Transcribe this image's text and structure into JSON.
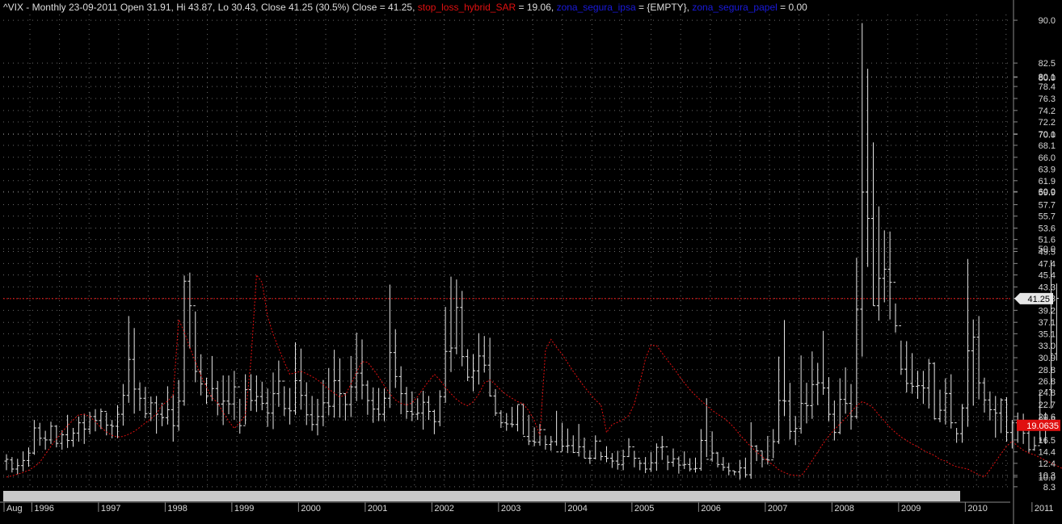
{
  "legend": {
    "symbol_line": "^VIX - Monthly 23-09-2011 Open 31.91, Hi 43.87, Lo 30.43, Close 41.25 (30.5%)",
    "close_label": "Close = 41.25,",
    "sar_name": "stop_loss_hybrid_SAR",
    "sar_value": "= 19.06,",
    "ipsa_name": "zona_segura_ipsa",
    "ipsa_value": "= {EMPTY},",
    "papel_name": "zona_segura_papel",
    "papel_value": "= 0.00"
  },
  "colors": {
    "background": "#000000",
    "bars": "#e6e6e6",
    "sar": "#e01010",
    "grid": "#6a6a6a",
    "last_close_tag": "#e6e6e6",
    "sar_tag": "#e01010"
  },
  "chart_data": {
    "type": "ohlc",
    "timeframe": "monthly",
    "y_tick_labels": [
      "90.0",
      "82.5",
      "80.0",
      "80.1",
      "78.4",
      "76.3",
      "74.2",
      "72.2",
      "70.0",
      "70.1",
      "68.1",
      "66.0",
      "63.9",
      "61.9",
      "60.0",
      "59.9",
      "57.7",
      "55.7",
      "53.6",
      "51.6",
      "50.0",
      "49.5",
      "47.4",
      "45.4",
      "43.3",
      "41.3",
      "39.2",
      "37.1",
      "35.1",
      "33.0",
      "30.9",
      "28.8",
      "26.8",
      "24.8",
      "22.7",
      "20.0",
      "20.6",
      "16.5",
      "14.4",
      "12.4",
      "10.0",
      "10.3",
      "8.3"
    ],
    "x_tick_labels": [
      "Aug",
      "1996",
      "1997",
      "1998",
      "1999",
      "2000",
      "2001",
      "2002",
      "2003",
      "2004",
      "2005",
      "2006",
      "2007",
      "2008",
      "2009",
      "2010",
      "2011"
    ],
    "ylim": [
      8.0,
      91.0
    ],
    "x_start": "1995-08",
    "x_end": "2011-09",
    "last_close": 41.25,
    "last_close_label": "41.25",
    "sar_last": 19.06,
    "sar_last_label": "19.0635",
    "bars": [
      [
        12.8,
        14.0,
        11.2,
        13.1
      ],
      [
        13.0,
        13.5,
        10.8,
        11.4
      ],
      [
        11.4,
        13.2,
        10.5,
        12.0
      ],
      [
        12.0,
        14.5,
        11.0,
        12.9
      ],
      [
        12.9,
        15.2,
        11.8,
        14.2
      ],
      [
        14.2,
        20.0,
        13.9,
        18.6
      ],
      [
        18.6,
        19.5,
        15.5,
        16.8
      ],
      [
        16.8,
        18.1,
        14.8,
        16.5
      ],
      [
        16.5,
        19.7,
        15.8,
        18.9
      ],
      [
        18.9,
        19.1,
        15.2,
        15.9
      ],
      [
        15.9,
        18.2,
        14.8,
        17.4
      ],
      [
        17.4,
        20.9,
        15.1,
        16.4
      ],
      [
        16.4,
        18.6,
        15.3,
        17.7
      ],
      [
        17.7,
        20.6,
        16.2,
        19.5
      ],
      [
        19.5,
        21.1,
        15.8,
        18.4
      ],
      [
        18.4,
        21.4,
        17.5,
        20.6
      ],
      [
        20.6,
        21.9,
        18.0,
        19.9
      ],
      [
        19.9,
        22.0,
        18.4,
        21.5
      ],
      [
        21.5,
        21.3,
        17.3,
        19.1
      ],
      [
        19.1,
        20.0,
        16.8,
        18.9
      ],
      [
        18.9,
        22.6,
        16.8,
        21.0
      ],
      [
        21.0,
        26.3,
        19.0,
        24.3
      ],
      [
        24.3,
        38.2,
        23.0,
        30.6
      ],
      [
        30.6,
        36.1,
        21.1,
        25.4
      ],
      [
        25.4,
        26.6,
        21.6,
        23.8
      ],
      [
        23.8,
        25.8,
        20.3,
        21.1
      ],
      [
        21.1,
        24.1,
        19.8,
        23.0
      ],
      [
        23.0,
        24.2,
        17.6,
        21.0
      ],
      [
        21.0,
        23.0,
        18.9,
        20.4
      ],
      [
        20.4,
        25.9,
        19.2,
        21.8
      ],
      [
        21.8,
        24.5,
        16.2,
        19.0
      ],
      [
        19.0,
        27.0,
        18.1,
        23.3
      ],
      [
        23.3,
        45.3,
        22.5,
        44.3
      ],
      [
        44.3,
        45.8,
        32.5,
        40.0
      ],
      [
        40.0,
        39.0,
        26.6,
        28.5
      ],
      [
        28.5,
        31.5,
        24.3,
        26.3
      ],
      [
        26.3,
        27.4,
        22.8,
        24.2
      ],
      [
        24.2,
        31.2,
        23.3,
        25.5
      ],
      [
        25.5,
        26.8,
        20.8,
        22.8
      ],
      [
        22.8,
        27.8,
        19.1,
        23.3
      ],
      [
        23.3,
        27.8,
        21.0,
        22.8
      ],
      [
        22.8,
        28.6,
        20.0,
        25.8
      ],
      [
        25.8,
        23.7,
        17.6,
        19.0
      ],
      [
        19.0,
        28.0,
        19.2,
        25.3
      ],
      [
        25.3,
        28.0,
        21.6,
        23.4
      ],
      [
        23.4,
        27.8,
        21.4,
        24.1
      ],
      [
        24.1,
        26.7,
        21.7,
        22.9
      ],
      [
        22.9,
        25.5,
        18.8,
        21.2
      ],
      [
        21.2,
        28.3,
        18.4,
        24.6
      ],
      [
        24.6,
        30.4,
        22.3,
        26.8
      ],
      [
        26.8,
        25.9,
        20.7,
        22.0
      ],
      [
        22.0,
        25.6,
        19.2,
        21.6
      ],
      [
        21.6,
        33.6,
        20.9,
        26.9
      ],
      [
        26.9,
        32.5,
        21.8,
        24.3
      ],
      [
        24.3,
        26.6,
        19.1,
        20.9
      ],
      [
        20.9,
        24.2,
        18.1,
        19.2
      ],
      [
        19.2,
        23.7,
        17.3,
        20.6
      ],
      [
        20.6,
        27.0,
        18.9,
        23.0
      ],
      [
        23.0,
        29.1,
        20.8,
        22.4
      ],
      [
        22.4,
        32.3,
        20.4,
        26.9
      ],
      [
        26.9,
        30.8,
        20.4,
        24.6
      ],
      [
        24.6,
        24.7,
        19.9,
        22.7
      ],
      [
        22.7,
        31.2,
        20.5,
        25.8
      ],
      [
        25.8,
        35.3,
        23.3,
        28.2
      ],
      [
        28.2,
        34.1,
        23.6,
        26.1
      ],
      [
        26.1,
        26.9,
        20.9,
        23.4
      ],
      [
        23.4,
        25.7,
        19.5,
        21.9
      ],
      [
        21.9,
        25.6,
        19.8,
        21.0
      ],
      [
        21.0,
        25.5,
        19.8,
        23.8
      ],
      [
        23.8,
        43.7,
        22.1,
        31.8
      ],
      [
        31.8,
        35.9,
        25.6,
        27.6
      ],
      [
        27.6,
        29.4,
        21.0,
        24.6
      ],
      [
        24.6,
        25.8,
        20.2,
        21.5
      ],
      [
        21.5,
        25.0,
        19.8,
        21.0
      ],
      [
        21.0,
        23.8,
        20.0,
        21.2
      ],
      [
        21.2,
        25.1,
        18.3,
        23.1
      ],
      [
        23.1,
        24.2,
        20.0,
        21.5
      ],
      [
        21.5,
        21.8,
        17.5,
        19.7
      ],
      [
        19.7,
        25.2,
        18.9,
        24.1
      ],
      [
        24.1,
        39.8,
        23.0,
        32.0
      ],
      [
        32.0,
        45.1,
        28.4,
        32.6
      ],
      [
        32.6,
        44.6,
        31.5,
        39.7
      ],
      [
        39.7,
        42.6,
        29.4,
        31.1
      ],
      [
        31.1,
        32.4,
        26.8,
        27.5
      ],
      [
        27.5,
        31.5,
        25.0,
        28.6
      ],
      [
        28.6,
        35.2,
        26.2,
        31.2
      ],
      [
        31.2,
        34.7,
        28.3,
        29.6
      ],
      [
        29.6,
        34.4,
        24.1,
        24.2
      ],
      [
        24.2,
        25.4,
        20.7,
        21.2
      ],
      [
        21.2,
        21.7,
        18.6,
        19.5
      ],
      [
        19.5,
        21.2,
        18.1,
        19.3
      ],
      [
        19.3,
        22.3,
        18.7,
        19.2
      ],
      [
        19.2,
        22.6,
        18.0,
        22.7
      ],
      [
        22.7,
        22.9,
        17.4,
        17.1
      ],
      [
        17.1,
        20.9,
        15.6,
        16.3
      ],
      [
        16.3,
        18.7,
        15.4,
        16.1
      ],
      [
        16.1,
        19.3,
        15.5,
        18.3
      ],
      [
        18.3,
        17.3,
        14.8,
        15.7
      ],
      [
        15.7,
        17.2,
        14.6,
        16.2
      ],
      [
        16.2,
        21.6,
        15.5,
        14.4
      ],
      [
        14.4,
        19.5,
        14.5,
        15.4
      ],
      [
        15.4,
        18.5,
        14.2,
        15.5
      ],
      [
        15.5,
        17.3,
        14.2,
        14.3
      ],
      [
        14.3,
        19.3,
        13.6,
        15.3
      ],
      [
        15.3,
        16.9,
        13.3,
        13.3
      ],
      [
        13.3,
        14.7,
        12.3,
        13.3
      ],
      [
        13.3,
        17.3,
        13.1,
        16.3
      ],
      [
        16.3,
        14.4,
        12.9,
        13.6
      ],
      [
        13.6,
        15.4,
        12.6,
        13.3
      ],
      [
        13.3,
        14.2,
        11.6,
        12.8
      ],
      [
        12.8,
        14.6,
        11.3,
        12.2
      ],
      [
        12.2,
        14.8,
        11.2,
        13.6
      ],
      [
        13.6,
        16.8,
        13.5,
        15.3
      ],
      [
        15.3,
        14.6,
        11.7,
        13.3
      ],
      [
        13.3,
        13.0,
        11.2,
        12.4
      ],
      [
        12.4,
        13.5,
        10.7,
        11.4
      ],
      [
        11.4,
        14.4,
        10.9,
        12.5
      ],
      [
        12.5,
        15.9,
        11.1,
        15.2
      ],
      [
        15.2,
        17.2,
        13.0,
        15.3
      ],
      [
        15.3,
        13.8,
        11.2,
        12.6
      ],
      [
        12.6,
        15.0,
        11.8,
        13.2
      ],
      [
        13.2,
        13.6,
        10.6,
        12.1
      ],
      [
        12.1,
        14.5,
        11.4,
        12.2
      ],
      [
        12.2,
        13.3,
        11.0,
        11.4
      ],
      [
        11.4,
        13.4,
        10.8,
        11.5
      ],
      [
        11.5,
        18.4,
        11.1,
        16.4
      ],
      [
        16.4,
        23.8,
        13.5,
        13.1
      ],
      [
        13.1,
        18.0,
        12.7,
        14.2
      ],
      [
        14.2,
        14.4,
        11.7,
        12.2
      ],
      [
        12.2,
        13.5,
        11.1,
        11.7
      ],
      [
        11.7,
        12.5,
        10.3,
        11.1
      ],
      [
        11.1,
        11.1,
        10.3,
        10.9
      ],
      [
        10.9,
        13.0,
        9.6,
        11.6
      ],
      [
        11.6,
        13.4,
        9.9,
        10.4
      ],
      [
        10.4,
        19.6,
        9.7,
        15.4
      ],
      [
        15.4,
        15.6,
        12.8,
        14.6
      ],
      [
        14.6,
        14.6,
        11.7,
        13.1
      ],
      [
        13.1,
        17.2,
        12.2,
        13.0
      ],
      [
        13.0,
        18.4,
        13.3,
        16.2
      ],
      [
        16.2,
        31.1,
        15.8,
        23.4
      ],
      [
        23.4,
        37.5,
        20.7,
        23.3
      ],
      [
        23.3,
        26.5,
        16.6,
        18.0
      ],
      [
        18.0,
        20.7,
        15.6,
        18.5
      ],
      [
        18.5,
        31.3,
        17.6,
        22.9
      ],
      [
        22.9,
        26.5,
        19.4,
        22.5
      ],
      [
        22.5,
        32.0,
        20.2,
        26.2
      ],
      [
        26.2,
        30.0,
        22.6,
        26.5
      ],
      [
        26.5,
        35.6,
        24.4,
        25.6
      ],
      [
        25.6,
        27.5,
        19.8,
        21.0
      ],
      [
        21.0,
        23.4,
        16.4,
        17.8
      ],
      [
        17.8,
        27.3,
        17.5,
        23.6
      ],
      [
        23.6,
        29.2,
        21.1,
        22.9
      ],
      [
        22.9,
        26.3,
        18.3,
        20.6
      ],
      [
        20.6,
        48.4,
        20.2,
        39.4
      ],
      [
        39.4,
        89.5,
        31.1,
        59.9
      ],
      [
        59.9,
        81.5,
        46.8,
        55.3
      ],
      [
        55.3,
        68.6,
        40.0,
        40.0
      ],
      [
        40.0,
        57.4,
        37.4,
        44.8
      ],
      [
        44.8,
        53.2,
        40.6,
        46.4
      ],
      [
        46.4,
        53.0,
        37.6,
        44.1
      ],
      [
        44.1,
        40.4,
        35.3,
        36.5
      ],
      [
        36.5,
        33.9,
        27.9,
        28.9
      ],
      [
        28.9,
        33.8,
        24.8,
        26.4
      ],
      [
        26.4,
        31.7,
        24.6,
        25.9
      ],
      [
        25.9,
        28.6,
        23.7,
        26.0
      ],
      [
        26.0,
        28.6,
        22.8,
        25.6
      ],
      [
        25.6,
        30.7,
        22.0,
        29.9
      ],
      [
        29.9,
        30.1,
        20.1,
        20.2
      ],
      [
        20.2,
        25.3,
        19.6,
        21.7
      ],
      [
        21.7,
        27.3,
        19.2,
        24.6
      ],
      [
        24.6,
        28.0,
        18.5,
        19.5
      ],
      [
        19.5,
        18.6,
        16.0,
        17.6
      ],
      [
        17.6,
        22.8,
        16.0,
        22.1
      ],
      [
        22.1,
        48.2,
        18.8,
        32.1
      ],
      [
        32.1,
        37.6,
        22.5,
        34.5
      ],
      [
        34.5,
        38.2,
        23.6,
        26.5
      ],
      [
        26.5,
        27.4,
        21.3,
        23.5
      ],
      [
        23.5,
        25.0,
        19.9,
        21.8
      ],
      [
        21.8,
        24.2,
        16.9,
        21.2
      ],
      [
        21.2,
        23.8,
        17.7,
        23.5
      ],
      [
        23.5,
        24.0,
        16.2,
        17.8
      ],
      [
        17.8,
        20.0,
        15.0,
        19.5
      ],
      [
        19.5,
        21.3,
        16.0,
        18.4
      ],
      [
        18.4,
        21.1,
        15.8,
        17.7
      ],
      [
        17.7,
        18.9,
        14.3,
        14.8
      ],
      [
        14.8,
        17.1,
        14.6,
        15.5
      ],
      [
        15.5,
        25.0,
        16.1,
        16.5
      ],
      [
        16.5,
        21.3,
        15.8,
        25.3
      ],
      [
        25.3,
        48.0,
        22.0,
        31.6
      ],
      [
        31.6,
        43.9,
        30.4,
        41.3
      ]
    ],
    "sar": [
      10.0,
      10.2,
      10.5,
      10.8,
      11.2,
      11.8,
      12.6,
      14.0,
      15.4,
      16.7,
      17.9,
      19.0,
      20.0,
      20.9,
      21.0,
      20.6,
      19.7,
      18.7,
      17.9,
      17.3,
      17.0,
      17.1,
      17.5,
      18.0,
      18.7,
      19.5,
      20.2,
      21.1,
      22.6,
      23.3,
      24.3,
      37.6,
      35.4,
      32.7,
      30.2,
      27.8,
      25.7,
      23.9,
      23.0,
      21.3,
      19.8,
      18.5,
      19.6,
      20.8,
      30.4,
      45.4,
      44.1,
      38.1,
      35.0,
      32.5,
      30.1,
      28.0,
      28.3,
      28.5,
      28.1,
      27.6,
      27.0,
      26.2,
      25.4,
      24.7,
      24.0,
      24.4,
      26.3,
      28.3,
      30.2,
      30.1,
      28.9,
      27.5,
      26.0,
      24.6,
      23.5,
      22.9,
      22.6,
      23.0,
      24.1,
      25.5,
      26.8,
      28.0,
      27.0,
      25.7,
      24.6,
      23.6,
      22.9,
      22.5,
      23.2,
      24.5,
      26.5,
      27.0,
      26.2,
      25.2,
      24.4,
      23.8,
      23.2,
      22.8,
      21.6,
      19.9,
      17.3,
      32.2,
      34.1,
      32.7,
      31.5,
      30.0,
      28.5,
      27.1,
      25.8,
      24.6,
      23.5,
      22.6,
      17.8,
      19.2,
      19.6,
      20.1,
      20.8,
      22.8,
      26.6,
      30.7,
      33.1,
      33.0,
      31.7,
      30.4,
      29.2,
      27.8,
      26.5,
      25.3,
      24.3,
      23.4,
      22.5,
      21.7,
      21.0,
      20.4,
      19.6,
      18.6,
      17.4,
      16.3,
      15.3,
      14.4,
      13.6,
      12.8,
      12.1,
      11.3,
      10.8,
      10.4,
      10.3,
      10.2,
      11.4,
      12.9,
      14.4,
      15.9,
      17.2,
      18.3,
      19.3,
      20.3,
      21.4,
      22.5,
      23.2,
      22.8,
      22.1,
      20.9,
      19.8,
      18.7,
      17.8,
      17.0,
      16.4,
      15.8,
      15.3,
      14.7,
      14.2,
      13.8,
      13.1,
      12.8,
      12.2,
      11.8,
      11.6,
      11.4,
      10.9,
      10.4,
      10.0,
      11.3,
      12.7,
      14.1,
      15.4,
      16.3,
      15.4,
      14.7,
      14.2,
      13.9,
      13.4,
      12.9,
      12.5,
      12.0,
      11.5,
      11.0,
      10.5,
      10.0
    ]
  }
}
